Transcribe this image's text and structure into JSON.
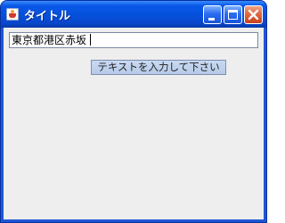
{
  "window": {
    "title": "タイトル",
    "icon": "java-app-icon",
    "controls": [
      "minimize",
      "maximize",
      "close"
    ]
  },
  "form": {
    "text_value": "東京都港区赤坂",
    "submit_label": "テキストを入力して下さい"
  },
  "colors": {
    "titlebar": "#0450db",
    "client_background": "#eeeeee",
    "close_button": "#e26840",
    "button_background": "#b6cbe8"
  }
}
